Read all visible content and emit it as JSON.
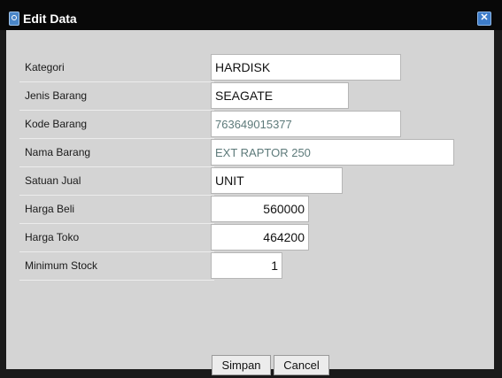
{
  "window": {
    "title": "Edit Data"
  },
  "form": {
    "fields": [
      {
        "label": "Kategori",
        "value": "HARDISK"
      },
      {
        "label": "Jenis Barang",
        "value": "SEAGATE"
      },
      {
        "label": "Kode Barang",
        "value": "763649015377"
      },
      {
        "label": "Nama Barang",
        "value": "EXT RAPTOR 250"
      },
      {
        "label": "Satuan Jual",
        "value": "UNIT"
      },
      {
        "label": "Harga Beli",
        "value": "560000"
      },
      {
        "label": "Harga Toko",
        "value": "464200"
      },
      {
        "label": "Minimum Stock",
        "value": "1"
      }
    ]
  },
  "buttons": {
    "save": "Simpan",
    "cancel": "Cancel"
  },
  "icons": {
    "window": "form-icon",
    "close": "close-icon"
  },
  "colors": {
    "titlebar": "#080808",
    "panel": "#d4d4d4",
    "close": "#3d7cc9",
    "readonly_text": "#5d7a7a"
  }
}
